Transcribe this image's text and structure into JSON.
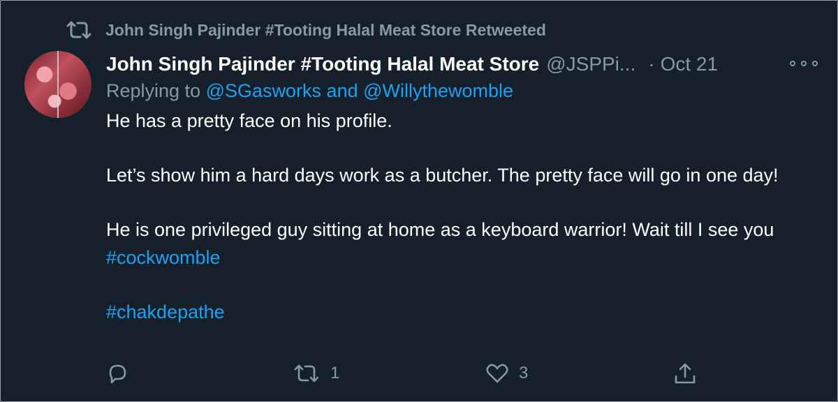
{
  "retweet_banner": {
    "icon": "retweet-icon",
    "text": "John Singh Pajinder #Tooting Halal Meat Store Retweeted"
  },
  "tweet": {
    "author_name": "John Singh Pajinder #Tooting Halal Meat Store",
    "author_handle": "@JSPPi...",
    "separator": "·",
    "date": "Oct 21",
    "replying_prefix": "Replying to",
    "replying_to": "@SGasworks and @Willythewomble",
    "body": {
      "p1": "He has a pretty face on his profile.",
      "p2": "Let’s show him a hard days work as a butcher. The pretty face will go in one day!",
      "p3_text": "He is one privileged guy sitting at home as a keyboard warrior! Wait till I see you",
      "p3_hashtag": "#cockwomble",
      "p4_hashtag": "#chakdepathe"
    }
  },
  "actions": {
    "reply": {
      "icon": "reply-icon",
      "count": ""
    },
    "retweet": {
      "icon": "retweet-icon",
      "count": "1"
    },
    "like": {
      "icon": "heart-icon",
      "count": "3"
    },
    "share": {
      "icon": "share-icon",
      "count": ""
    }
  },
  "colors": {
    "background": "#15202b",
    "secondary_text": "#8899a6",
    "link": "#1da1f2",
    "primary_text": "#ffffff"
  }
}
